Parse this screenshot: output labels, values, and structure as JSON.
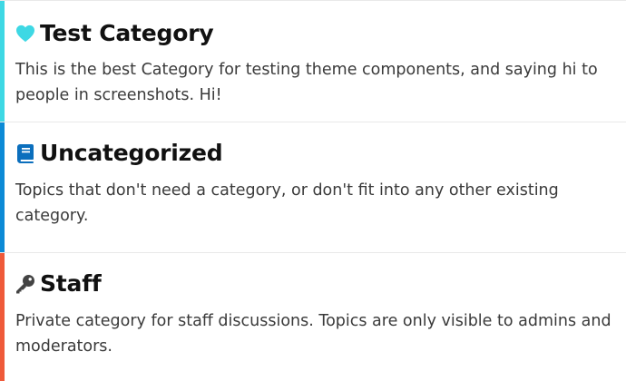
{
  "categories": [
    {
      "name": "Test Category",
      "description": "This is the best Category for testing theme components, and saying hi to people in screenshots. Hi!",
      "icon": "heart-icon",
      "color": "#3ed8e4",
      "icon_color": "#3ed8e4"
    },
    {
      "name": "Uncategorized",
      "description": "Topics that don't need a category, or don't fit into any other existing category.",
      "icon": "book-icon",
      "color": "#0c8ad6",
      "icon_color": "#0b6fbd"
    },
    {
      "name": "Staff",
      "description": "Private category for staff discussions. Topics are only visible to admins and moderators.",
      "icon": "key-icon",
      "color": "#ef5a3a",
      "icon_color": "#444444"
    }
  ]
}
